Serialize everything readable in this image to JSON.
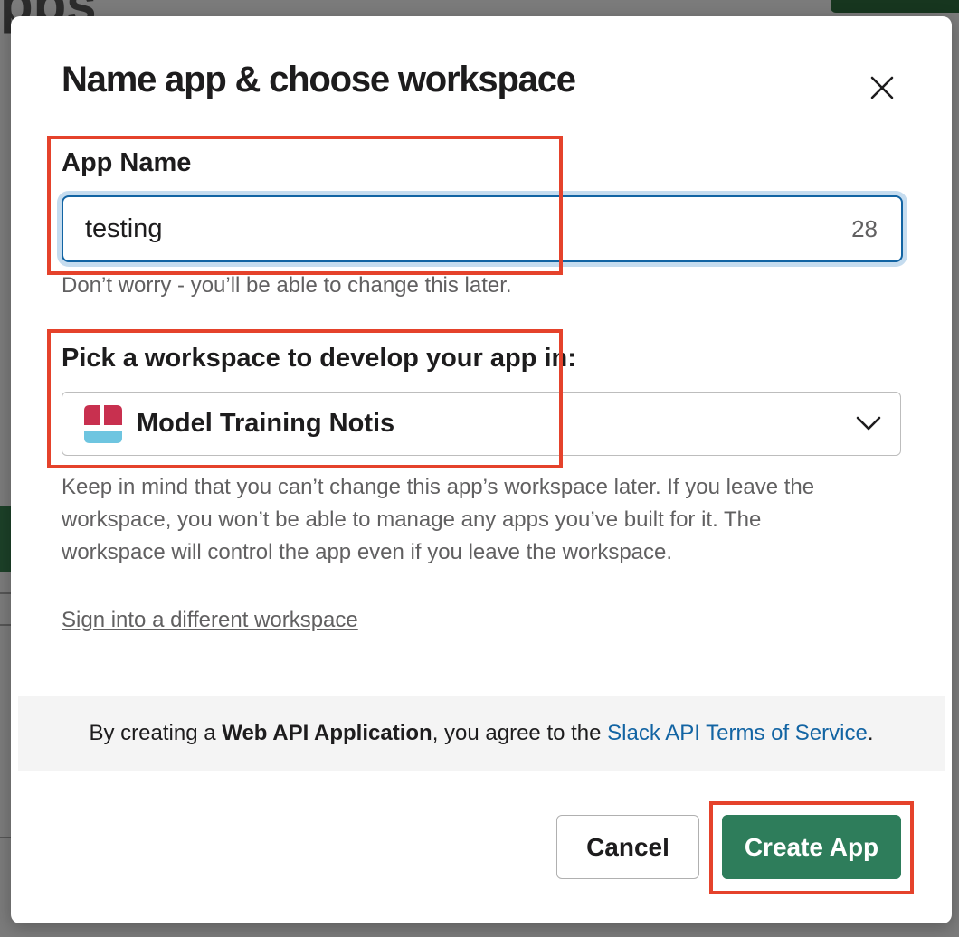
{
  "background": {
    "title_fragment": "pps"
  },
  "modal": {
    "title": "Name app & choose workspace",
    "close_icon": "close-icon",
    "app_name": {
      "label": "App Name",
      "value": "testing",
      "char_count": "28",
      "hint": "Don’t worry - you’ll be able to change this later."
    },
    "workspace": {
      "label": "Pick a workspace to develop your app in:",
      "selected": "Model Training Notis",
      "logo_icon": "workspace-logo-icon",
      "chevron_icon": "chevron-down-icon",
      "hint_lines": [
        "Keep in mind that you can’t change this app’s workspace later. If you leave the",
        "workspace, you won’t be able to manage any apps you’ve built for it. The",
        "workspace will control the app even if you leave the workspace."
      ]
    },
    "sign_in_link": "Sign into a different workspace",
    "terms": {
      "prefix": "By creating a ",
      "bold": "Web API Application",
      "middle": ", you agree to the ",
      "link": "Slack API Terms of Service",
      "suffix": "."
    },
    "buttons": {
      "cancel": "Cancel",
      "create": "Create App"
    }
  },
  "colors": {
    "accent_blue": "#1264a3",
    "create_green": "#2e7d5b",
    "highlight_red": "#e5422b",
    "logo_red": "#c8304f",
    "logo_blue": "#6ec5e0"
  }
}
